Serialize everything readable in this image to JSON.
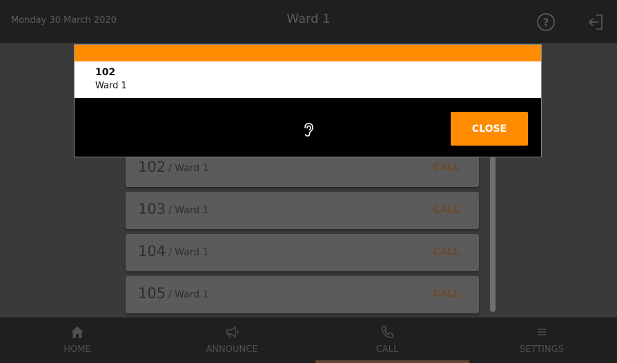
{
  "header": {
    "date": "Monday 30 March 2020",
    "title": "Ward 1",
    "help_icon": "help-circle-icon",
    "logout_icon": "logout-icon"
  },
  "calls": [
    {
      "number": "102",
      "ward": "/ Ward 1",
      "action": "CALL"
    },
    {
      "number": "103",
      "ward": "/ Ward 1",
      "action": "CALL"
    },
    {
      "number": "104",
      "ward": "/ Ward 1",
      "action": "CALL"
    },
    {
      "number": "105",
      "ward": "/ Ward 1",
      "action": "CALL"
    }
  ],
  "modal": {
    "number": "102",
    "ward": "Ward 1",
    "status_icon": "ear-listen-icon",
    "close_label": "CLOSE"
  },
  "nav": {
    "items": [
      {
        "label": "HOME",
        "icon": "home-icon"
      },
      {
        "label": "ANNOUNCE",
        "icon": "megaphone-icon"
      },
      {
        "label": "CALL",
        "icon": "phone-icon"
      },
      {
        "label": "SETTINGS",
        "icon": "menu-icon"
      }
    ],
    "active": "CALL"
  },
  "colors": {
    "accent": "#ff8c00",
    "topbar": "#1f1f1f",
    "background": "#3a3a3a",
    "item": "#5b5b5b"
  }
}
